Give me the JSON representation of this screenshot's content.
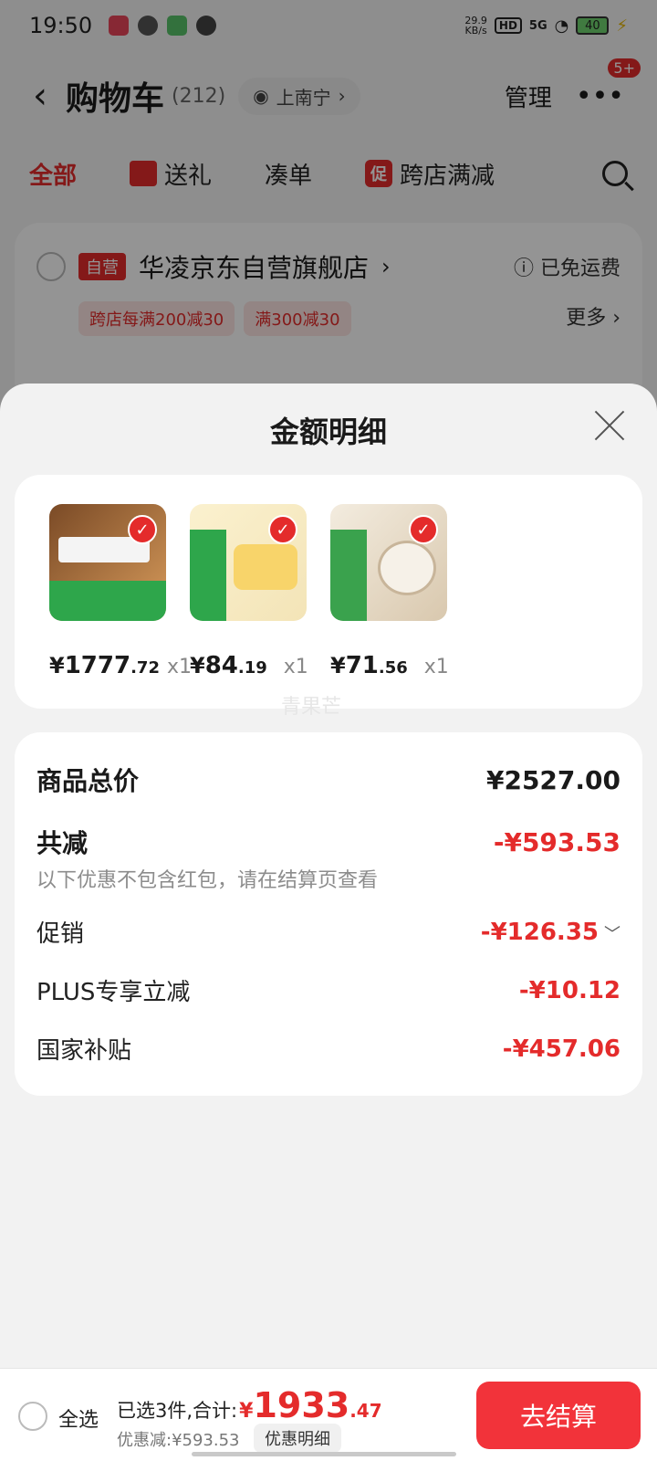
{
  "status_bar": {
    "time": "19:50",
    "net_speed": "29.9\nKB/s",
    "hd": "HD",
    "signal": "5G",
    "battery": "40"
  },
  "cart_header": {
    "title": "购物车",
    "count": "(212)",
    "location": "上南宁",
    "manage": "管理",
    "badge": "5+"
  },
  "cart_tabs": [
    {
      "label": "全部",
      "active": true
    },
    {
      "label": "送礼",
      "active": false
    },
    {
      "label": "凑单",
      "active": false
    },
    {
      "label": "跨店满减",
      "active": false,
      "tag": "促"
    }
  ],
  "store": {
    "self_operated_tag": "自营",
    "name": "华凌京东自营旗舰店",
    "shipping": "已免运费",
    "promos": [
      "跨店每满200减30",
      "满300减30"
    ],
    "more": "更多"
  },
  "sheet": {
    "title": "金额明细",
    "watermark": "青果芒",
    "products": [
      {
        "yen": "¥",
        "int": "1777",
        "dec": ".72",
        "qty": "x1",
        "color_a": "#c98a4a",
        "color_b": "#2ea64b"
      },
      {
        "yen": "¥",
        "int": "84",
        "dec": ".19",
        "qty": "x1",
        "color_a": "#f6e7b8",
        "color_b": "#2ea64b"
      },
      {
        "yen": "¥",
        "int": "71",
        "dec": ".56",
        "qty": "x1",
        "color_a": "#ede2cf",
        "color_b": "#3aa24d"
      }
    ],
    "totals": {
      "goods_total_label": "商品总价",
      "goods_total_value": "¥2527.00",
      "total_discount_label": "共减",
      "total_discount_value": "-¥593.53",
      "note": "以下优惠不包含红包，请在结算页查看",
      "items": [
        {
          "label": "促销",
          "value": "-¥126.35",
          "expandable": true
        },
        {
          "label": "PLUS专享立减",
          "value": "-¥10.12",
          "expandable": false
        },
        {
          "label": "国家补贴",
          "value": "-¥457.06",
          "expandable": false
        }
      ]
    }
  },
  "bottom_bar": {
    "select_all": "全选",
    "selected_summary": "已选3件,合计:",
    "total_yen": "¥",
    "total_int": "1933",
    "total_dec": ".47",
    "discount": "优惠减:¥593.53",
    "detail_button": "优惠明细",
    "checkout": "去结算"
  },
  "colors": {
    "accent_red": "#e42b2b",
    "checkout_red": "#f2333a"
  }
}
